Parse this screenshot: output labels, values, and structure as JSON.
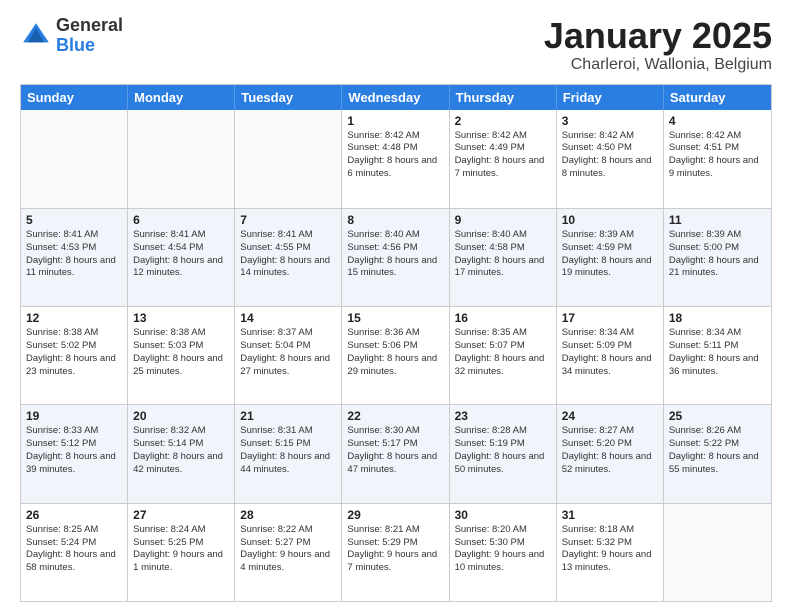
{
  "logo": {
    "general": "General",
    "blue": "Blue"
  },
  "title": {
    "month": "January 2025",
    "location": "Charleroi, Wallonia, Belgium"
  },
  "header_days": [
    "Sunday",
    "Monday",
    "Tuesday",
    "Wednesday",
    "Thursday",
    "Friday",
    "Saturday"
  ],
  "weeks": [
    {
      "alt": false,
      "cells": [
        {
          "day": "",
          "info": ""
        },
        {
          "day": "",
          "info": ""
        },
        {
          "day": "",
          "info": ""
        },
        {
          "day": "1",
          "info": "Sunrise: 8:42 AM\nSunset: 4:48 PM\nDaylight: 8 hours and 6 minutes."
        },
        {
          "day": "2",
          "info": "Sunrise: 8:42 AM\nSunset: 4:49 PM\nDaylight: 8 hours and 7 minutes."
        },
        {
          "day": "3",
          "info": "Sunrise: 8:42 AM\nSunset: 4:50 PM\nDaylight: 8 hours and 8 minutes."
        },
        {
          "day": "4",
          "info": "Sunrise: 8:42 AM\nSunset: 4:51 PM\nDaylight: 8 hours and 9 minutes."
        }
      ]
    },
    {
      "alt": true,
      "cells": [
        {
          "day": "5",
          "info": "Sunrise: 8:41 AM\nSunset: 4:53 PM\nDaylight: 8 hours and 11 minutes."
        },
        {
          "day": "6",
          "info": "Sunrise: 8:41 AM\nSunset: 4:54 PM\nDaylight: 8 hours and 12 minutes."
        },
        {
          "day": "7",
          "info": "Sunrise: 8:41 AM\nSunset: 4:55 PM\nDaylight: 8 hours and 14 minutes."
        },
        {
          "day": "8",
          "info": "Sunrise: 8:40 AM\nSunset: 4:56 PM\nDaylight: 8 hours and 15 minutes."
        },
        {
          "day": "9",
          "info": "Sunrise: 8:40 AM\nSunset: 4:58 PM\nDaylight: 8 hours and 17 minutes."
        },
        {
          "day": "10",
          "info": "Sunrise: 8:39 AM\nSunset: 4:59 PM\nDaylight: 8 hours and 19 minutes."
        },
        {
          "day": "11",
          "info": "Sunrise: 8:39 AM\nSunset: 5:00 PM\nDaylight: 8 hours and 21 minutes."
        }
      ]
    },
    {
      "alt": false,
      "cells": [
        {
          "day": "12",
          "info": "Sunrise: 8:38 AM\nSunset: 5:02 PM\nDaylight: 8 hours and 23 minutes."
        },
        {
          "day": "13",
          "info": "Sunrise: 8:38 AM\nSunset: 5:03 PM\nDaylight: 8 hours and 25 minutes."
        },
        {
          "day": "14",
          "info": "Sunrise: 8:37 AM\nSunset: 5:04 PM\nDaylight: 8 hours and 27 minutes."
        },
        {
          "day": "15",
          "info": "Sunrise: 8:36 AM\nSunset: 5:06 PM\nDaylight: 8 hours and 29 minutes."
        },
        {
          "day": "16",
          "info": "Sunrise: 8:35 AM\nSunset: 5:07 PM\nDaylight: 8 hours and 32 minutes."
        },
        {
          "day": "17",
          "info": "Sunrise: 8:34 AM\nSunset: 5:09 PM\nDaylight: 8 hours and 34 minutes."
        },
        {
          "day": "18",
          "info": "Sunrise: 8:34 AM\nSunset: 5:11 PM\nDaylight: 8 hours and 36 minutes."
        }
      ]
    },
    {
      "alt": true,
      "cells": [
        {
          "day": "19",
          "info": "Sunrise: 8:33 AM\nSunset: 5:12 PM\nDaylight: 8 hours and 39 minutes."
        },
        {
          "day": "20",
          "info": "Sunrise: 8:32 AM\nSunset: 5:14 PM\nDaylight: 8 hours and 42 minutes."
        },
        {
          "day": "21",
          "info": "Sunrise: 8:31 AM\nSunset: 5:15 PM\nDaylight: 8 hours and 44 minutes."
        },
        {
          "day": "22",
          "info": "Sunrise: 8:30 AM\nSunset: 5:17 PM\nDaylight: 8 hours and 47 minutes."
        },
        {
          "day": "23",
          "info": "Sunrise: 8:28 AM\nSunset: 5:19 PM\nDaylight: 8 hours and 50 minutes."
        },
        {
          "day": "24",
          "info": "Sunrise: 8:27 AM\nSunset: 5:20 PM\nDaylight: 8 hours and 52 minutes."
        },
        {
          "day": "25",
          "info": "Sunrise: 8:26 AM\nSunset: 5:22 PM\nDaylight: 8 hours and 55 minutes."
        }
      ]
    },
    {
      "alt": false,
      "cells": [
        {
          "day": "26",
          "info": "Sunrise: 8:25 AM\nSunset: 5:24 PM\nDaylight: 8 hours and 58 minutes."
        },
        {
          "day": "27",
          "info": "Sunrise: 8:24 AM\nSunset: 5:25 PM\nDaylight: 9 hours and 1 minute."
        },
        {
          "day": "28",
          "info": "Sunrise: 8:22 AM\nSunset: 5:27 PM\nDaylight: 9 hours and 4 minutes."
        },
        {
          "day": "29",
          "info": "Sunrise: 8:21 AM\nSunset: 5:29 PM\nDaylight: 9 hours and 7 minutes."
        },
        {
          "day": "30",
          "info": "Sunrise: 8:20 AM\nSunset: 5:30 PM\nDaylight: 9 hours and 10 minutes."
        },
        {
          "day": "31",
          "info": "Sunrise: 8:18 AM\nSunset: 5:32 PM\nDaylight: 9 hours and 13 minutes."
        },
        {
          "day": "",
          "info": ""
        }
      ]
    }
  ]
}
